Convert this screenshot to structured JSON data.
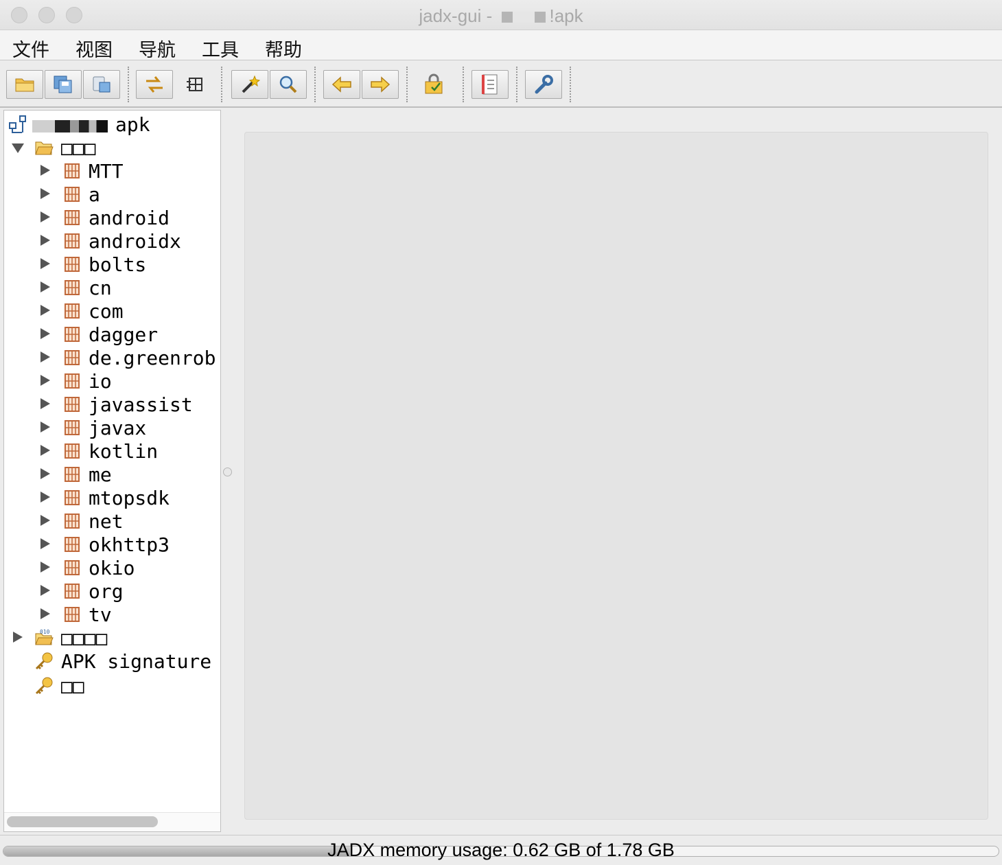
{
  "window": {
    "title_prefix": "jadx-gui - ",
    "title_suffix": "!apk"
  },
  "menu": [
    "文件",
    "视图",
    "导航",
    "工具",
    "帮助"
  ],
  "toolbar": {
    "icons": [
      "open-file-icon",
      "save-all-icon",
      "export-icon",
      "sync-icon",
      "flatten-packages-icon",
      "decompile-wand-icon",
      "search-icon",
      "back-arrow-icon",
      "forward-arrow-icon",
      "deobfuscation-icon",
      "log-viewer-icon",
      "preferences-icon"
    ]
  },
  "tree": {
    "root_label": "apk",
    "source_folder": "□□□",
    "packages": [
      "MTT",
      "a",
      "android",
      "androidx",
      "bolts",
      "cn",
      "com",
      "dagger",
      "de.greenrob",
      "io",
      "javassist",
      "javax",
      "kotlin",
      "me",
      "mtopsdk",
      "net",
      "okhttp3",
      "okio",
      "org",
      "tv"
    ],
    "resources_folder": "□□□□",
    "apk_signature": "APK signature",
    "summary": "□□"
  },
  "status": {
    "text": "JADX memory usage: 0.62 GB of 1.78 GB",
    "memory_used_gb": 0.62,
    "memory_total_gb": 1.78
  },
  "colors": {
    "package_icon": "#c0683a",
    "folder_icon": "#e9b04a",
    "key_icon": "#e0a21b"
  }
}
